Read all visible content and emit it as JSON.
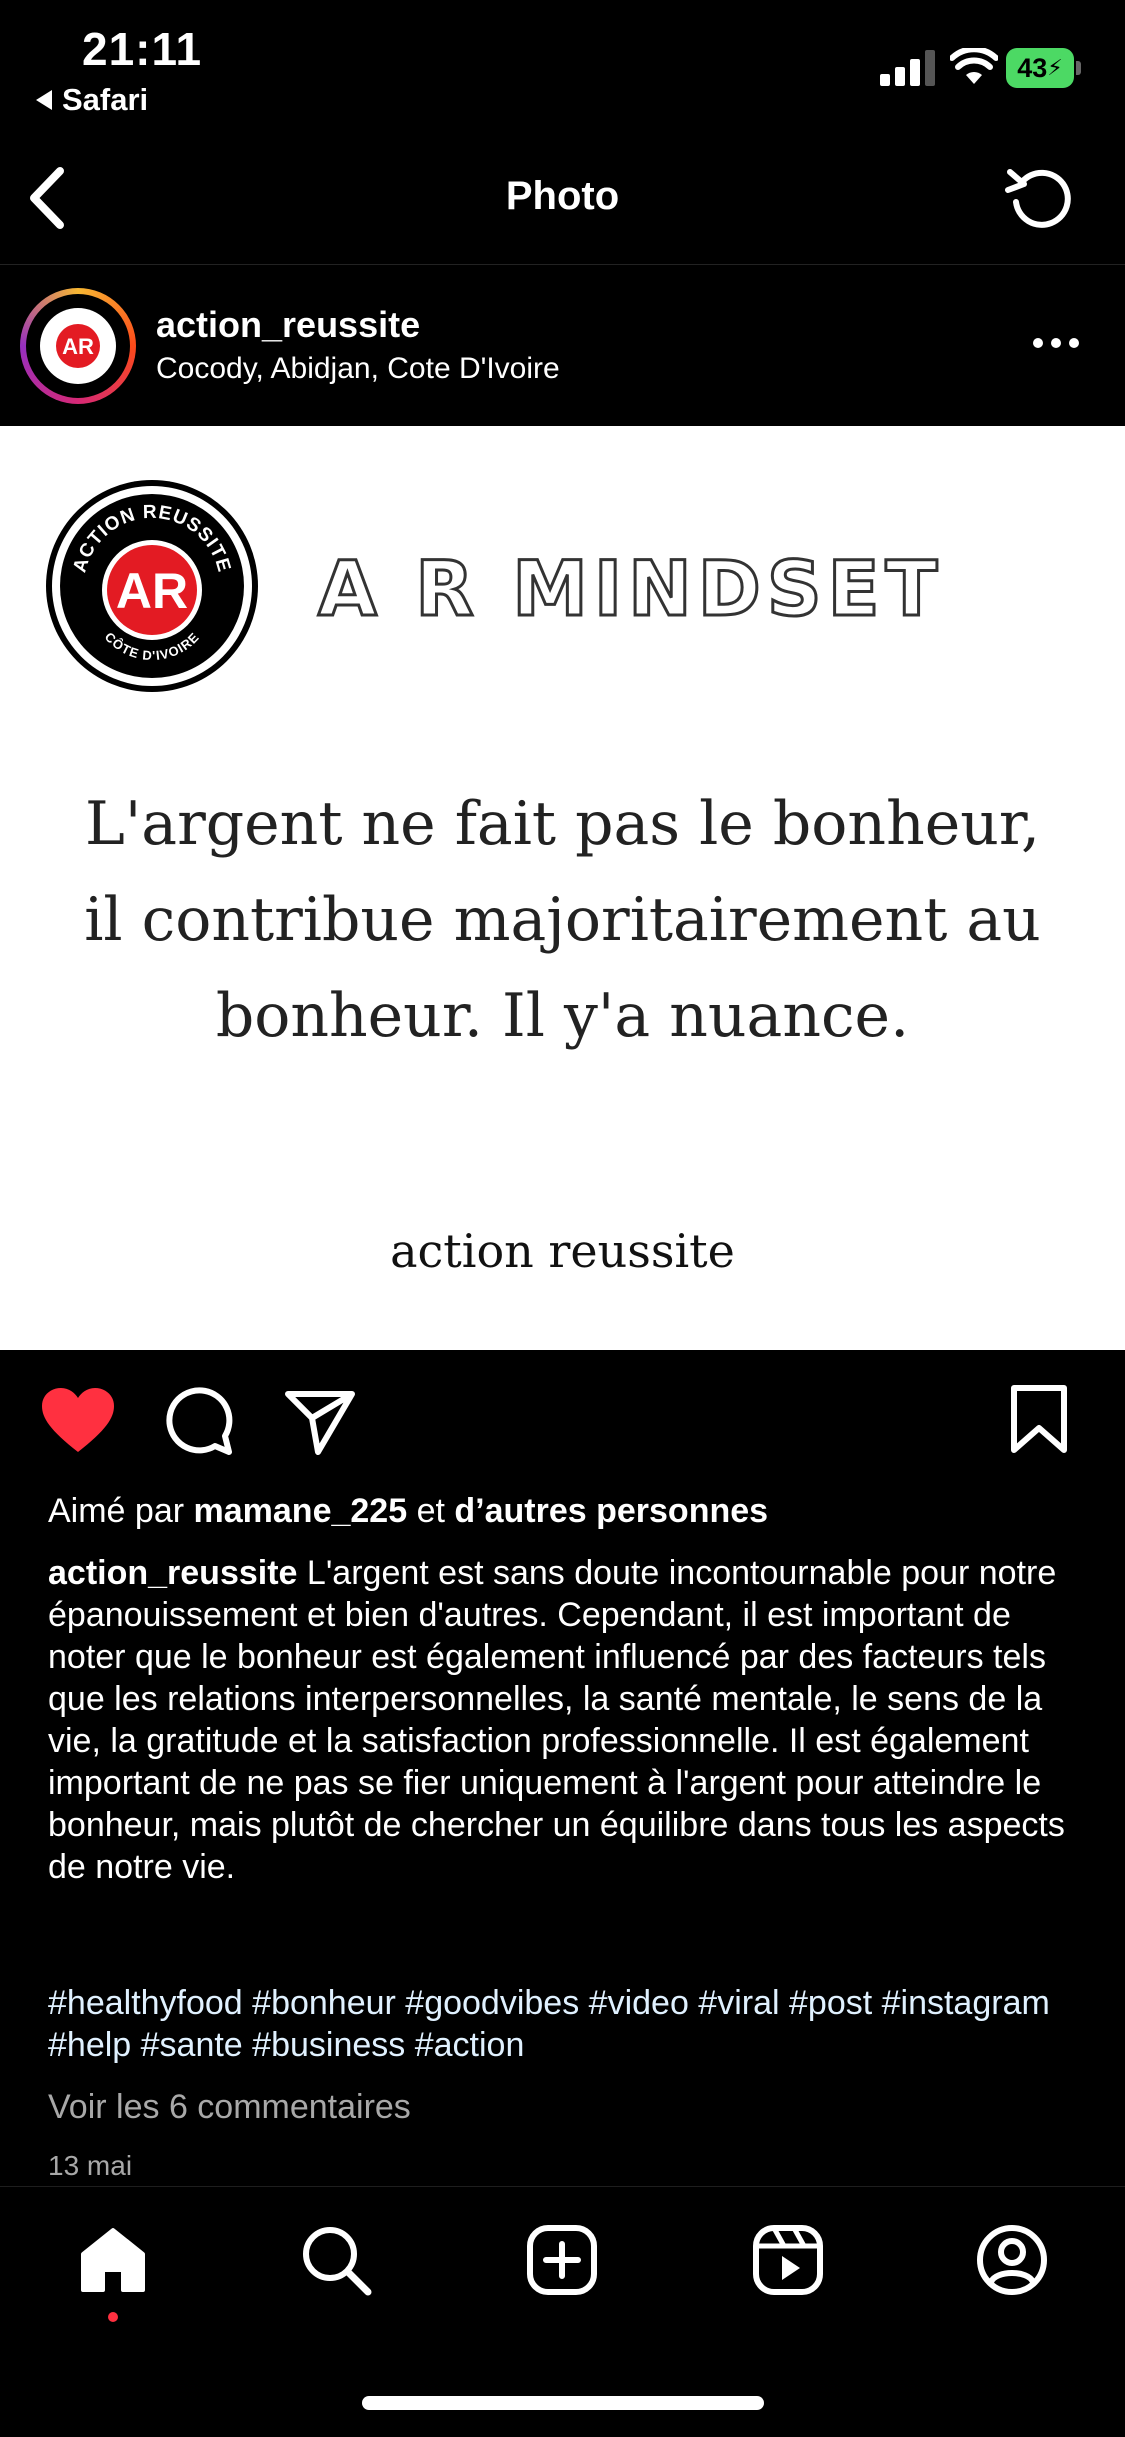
{
  "status_bar": {
    "time": "21:11",
    "back_app": "Safari",
    "battery": "43"
  },
  "nav": {
    "title": "Photo"
  },
  "post": {
    "username": "action_reussite",
    "location": "Cocody, Abidjan, Cote D'Ivoire",
    "image": {
      "logo_text_top": "ACTION REUSSITE",
      "logo_monogram": "AR",
      "logo_text_bottom": "CÔTE D'IVOIRE",
      "headline": "A R MINDSET",
      "quote": "L'argent ne fait pas le bonheur, il contribue majoritairement au bonheur. Il y'a nuance.",
      "signature": "action reussite"
    },
    "liked": true,
    "likes_prefix": "Aimé par",
    "likes_user": "mamane_225",
    "likes_joiner": "et",
    "likes_others": "d’autres personnes",
    "caption_user": "action_reussite",
    "caption_text": "L'argent est sans doute incontournable pour notre épanouissement et bien d'autres. Cependant, il est important de noter que le bonheur est également influencé par des facteurs tels que les relations interpersonnelles, la santé mentale, le sens de la vie, la gratitude et la satisfaction professionnelle. Il est également important de ne pas se fier uniquement à l'argent pour atteindre le bonheur, mais plutôt de chercher un équilibre dans tous les aspects de notre vie.",
    "hashtags": "#healthyfood #bonheur #goodvibes #video #viral #post #instagram #help #sante #business #action",
    "view_comments": "Voir les 6 commentaires",
    "date": "13 mai"
  },
  "tabbar": {
    "items": [
      "home-icon",
      "search-icon",
      "create-icon",
      "reels-icon",
      "profile-icon"
    ],
    "active": "home-icon"
  },
  "colors": {
    "like_red": "#ff3040",
    "logo_red": "#e31b23",
    "battery_green": "#4cd964"
  }
}
